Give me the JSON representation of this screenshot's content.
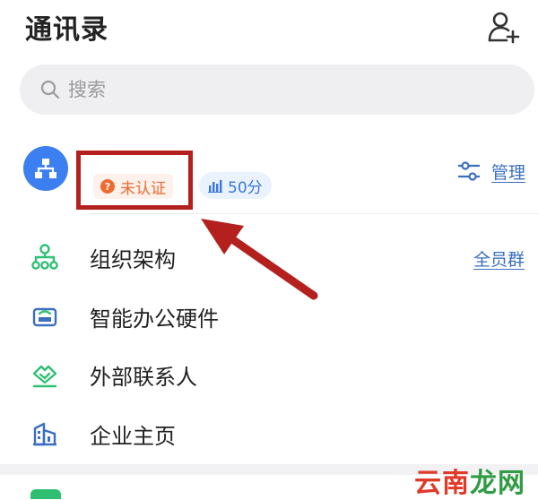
{
  "header": {
    "title": "通讯录"
  },
  "search": {
    "placeholder": "搜索"
  },
  "org": {
    "verify_badge": "未认证",
    "score_badge": "50分",
    "manage_label": "管理"
  },
  "menu": {
    "items": [
      {
        "label": "组织架构",
        "icon": "org-structure-icon"
      },
      {
        "label": "智能办公硬件",
        "icon": "office-hardware-icon"
      },
      {
        "label": "外部联系人",
        "icon": "handshake-icon"
      },
      {
        "label": "企业主页",
        "icon": "building-icon"
      }
    ],
    "all_staff_label": "全员群"
  },
  "watermark": {
    "part1": "云南",
    "part2": "龙网"
  },
  "colors": {
    "accent_blue": "#3c7ff0",
    "link_blue": "#3a6fbf",
    "warning_orange": "#f06a30",
    "annotation_red": "#b3201e",
    "menu_green": "#2fbf73"
  }
}
